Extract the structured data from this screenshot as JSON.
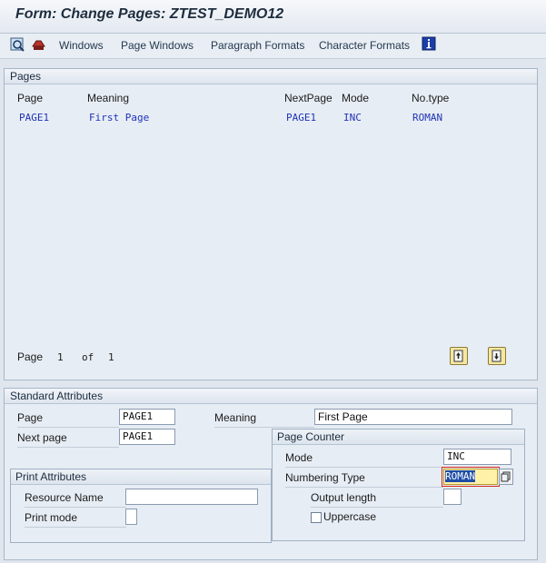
{
  "window": {
    "title": "Form: Change Pages: ZTEST_DEMO12"
  },
  "toolbar": {
    "items": [
      "Windows",
      "Page Windows",
      "Paragraph Formats",
      "Character Formats"
    ]
  },
  "pages_panel": {
    "title": "Pages",
    "columns": [
      "Page",
      "Meaning",
      "NextPage",
      "Mode",
      "No.type"
    ],
    "rows": [
      {
        "page": "PAGE1",
        "meaning": "First Page",
        "next_page": "PAGE1",
        "mode": "INC",
        "no_type": "ROMAN"
      }
    ],
    "pager": {
      "page_label": "Page",
      "current": "1",
      "of_label": "of",
      "total": "1"
    }
  },
  "standard_attributes": {
    "title": "Standard Attributes",
    "page_label": "Page",
    "page_value": "PAGE1",
    "meaning_label": "Meaning",
    "meaning_value": "First Page",
    "next_page_label": "Next page",
    "next_page_value": "PAGE1",
    "print_attributes": {
      "title": "Print Attributes",
      "resource_name_label": "Resource Name",
      "resource_name_value": "",
      "print_mode_label": "Print mode",
      "print_mode_value": ""
    },
    "page_counter": {
      "title": "Page Counter",
      "mode_label": "Mode",
      "mode_value": "INC",
      "numbering_type_label": "Numbering Type",
      "numbering_type_value": "ROMAN",
      "output_length_label": "Output length",
      "output_length_value": "",
      "uppercase_label": "Uppercase",
      "uppercase_checked": false
    }
  }
}
